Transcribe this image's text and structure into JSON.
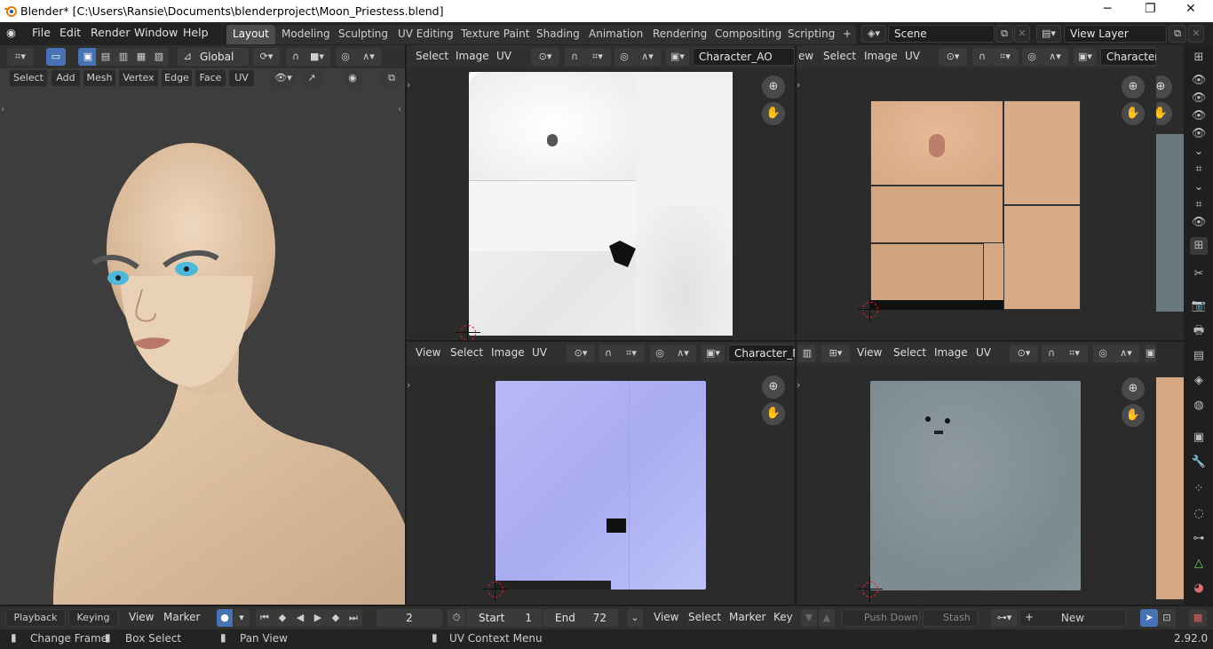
{
  "window": {
    "title": "Blender* [C:\\Users\\Ransie\\Documents\\blenderproject\\Moon_Priestess.blend]",
    "minimize": "─",
    "maximize": "❐",
    "close": "✕"
  },
  "menu": [
    "File",
    "Edit",
    "Render",
    "Window",
    "Help"
  ],
  "workspaces": [
    "Layout",
    "Modeling",
    "Sculpting",
    "UV Editing",
    "Texture Paint",
    "Shading",
    "Animation",
    "Rendering",
    "Compositing",
    "Scripting"
  ],
  "workspace_add": "+",
  "scene": {
    "name": "Scene",
    "view_layer": "View Layer"
  },
  "viewport3d": {
    "orientation": "Global",
    "menus": [
      "Select",
      "Add",
      "Mesh",
      "Vertex",
      "Edge",
      "Face",
      "UV"
    ]
  },
  "uv_editors": [
    {
      "menus": [
        "Select",
        "Image",
        "UV"
      ],
      "image": "Character_AO"
    },
    {
      "menus": [
        "ew",
        "Select",
        "Image",
        "UV"
      ],
      "image": "Character_"
    },
    {
      "menus": [
        "View",
        "Select",
        "Image",
        "UV"
      ],
      "image": "Character_No"
    },
    {
      "menus": [
        "View",
        "Select",
        "Image",
        "UV"
      ],
      "image": ""
    }
  ],
  "timeline": {
    "playback": "Playback",
    "keying": "Keying",
    "view": "View",
    "marker": "Marker",
    "current_frame": "2",
    "start_label": "Start",
    "start": "1",
    "end_label": "End",
    "end": "72"
  },
  "dopesheet": {
    "menus": [
      "View",
      "Select",
      "Marker",
      "Key"
    ],
    "push_down": "Push Down",
    "stash": "Stash",
    "new": "New"
  },
  "status": {
    "change_frame": "Change Frame",
    "box_select": "Box Select",
    "pan_view": "Pan View",
    "uv_context_menu": "UV Context Menu",
    "version": "2.92.0"
  }
}
